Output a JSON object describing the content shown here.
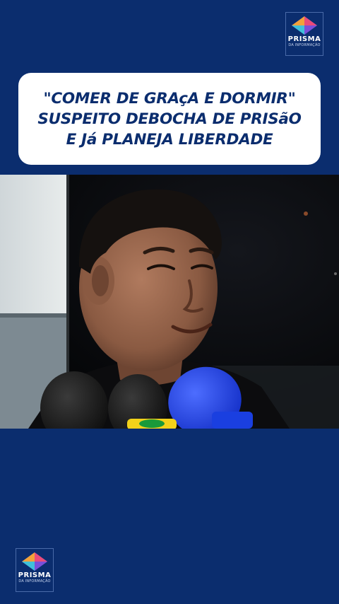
{
  "brand": {
    "name": "PRISMA",
    "tagline": "DA INFORMAÇÃO"
  },
  "headline": {
    "lines": [
      "\"COMER DE GRAçA E DORMIR\"",
      "SUSPEITO DEBOCHA DE PRISãO",
      "E Já PLANEJA LIBERDADE"
    ]
  },
  "colors": {
    "background": "#0b2d6e",
    "headline_box": "#ffffff",
    "headline_text": "#0b2d6e",
    "microphone_blue": "#1a3fe0",
    "microphone_yellow": "#f2d21a"
  },
  "video": {
    "scene": "man-being-interviewed-with-microphones"
  }
}
